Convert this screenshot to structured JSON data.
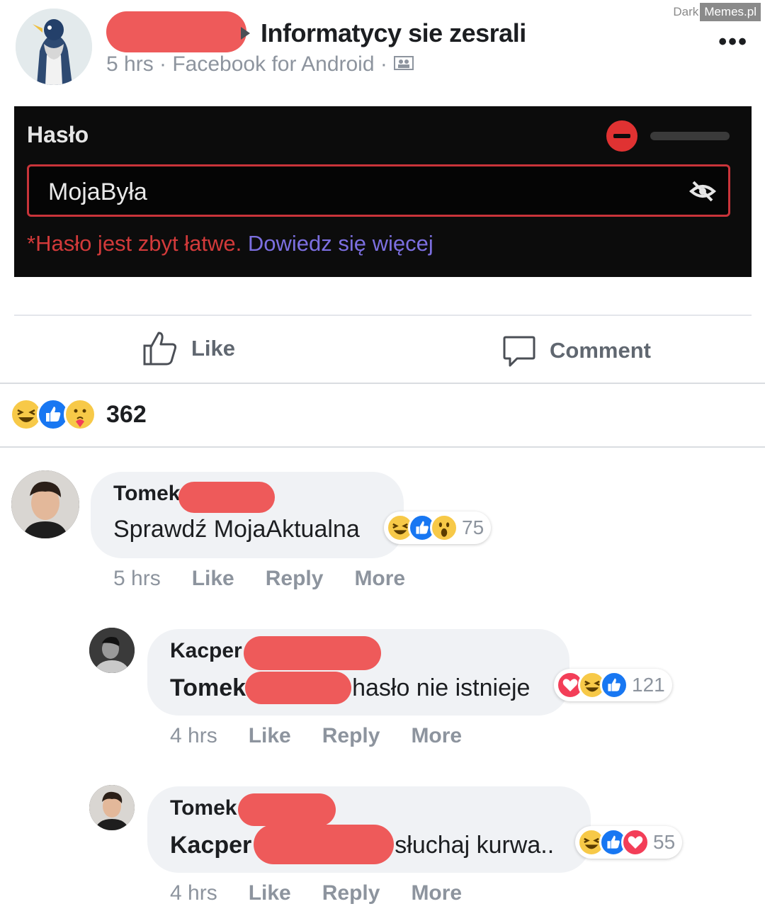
{
  "watermark": {
    "dark": "Dark",
    "memes": "Memes.pl"
  },
  "post": {
    "group_title": "Informatycy sie zesrali",
    "meta": "5 hrs · Facebook for Android ·",
    "menu_icon": "more-icon"
  },
  "password_card": {
    "label": "Hasło",
    "value": "MojaByła",
    "error": "*Hasło jest zbyt łatwe.",
    "link": "Dowiedz się więcej",
    "accent": "#c9343a"
  },
  "actions": {
    "like": "Like",
    "comment": "Comment"
  },
  "reactions": {
    "count": "362",
    "icons": [
      "haha",
      "like",
      "care"
    ]
  },
  "comments": [
    {
      "name": "Tomek",
      "text": "Sprawdź MojaAktualna",
      "reactions": [
        "haha",
        "like",
        "wow"
      ],
      "reaction_count": "75",
      "time": "5 hrs",
      "like": "Like",
      "reply": "Reply",
      "more": "More"
    },
    {
      "name": "Kacper",
      "mention": "Tomek",
      "text": "hasło nie istnieje",
      "reactions": [
        "love",
        "haha",
        "like"
      ],
      "reaction_count": "121",
      "time": "4 hrs",
      "like": "Like",
      "reply": "Reply",
      "more": "More"
    },
    {
      "name": "Tomek",
      "mention": "Kacper",
      "text": "słuchaj kurwa..",
      "reactions": [
        "haha",
        "like",
        "love"
      ],
      "reaction_count": "55",
      "time": "4 hrs",
      "like": "Like",
      "reply": "Reply",
      "more": "More"
    }
  ]
}
